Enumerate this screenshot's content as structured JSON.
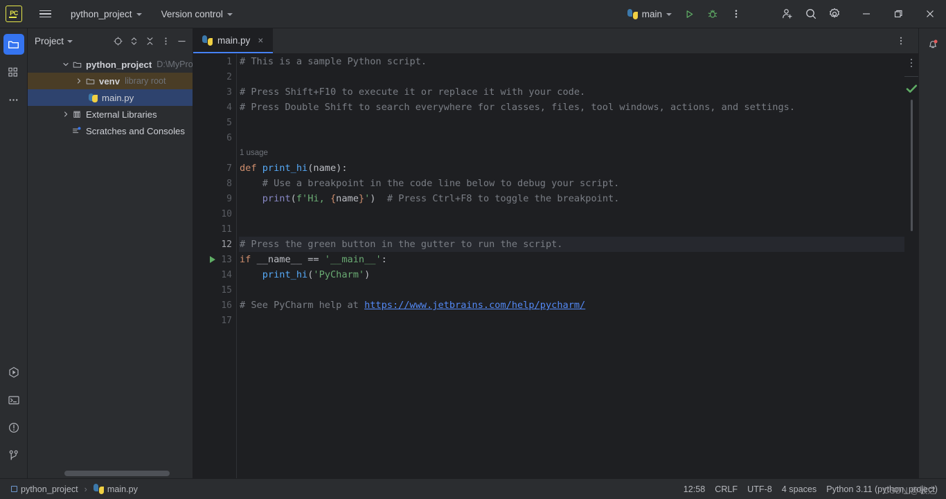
{
  "titlebar": {
    "logo": "pycharm-logo",
    "project_name": "python_project",
    "version_control": "Version control",
    "run_config": "main",
    "icons": {
      "menu": "hamburger-icon",
      "run": "run-icon",
      "debug": "debug-icon",
      "more": "more-vertical-icon",
      "account": "user-add-icon",
      "search": "search-icon",
      "settings": "gear-icon",
      "minimize": "minimize-icon",
      "maximize": "maximize-icon",
      "close": "close-icon"
    }
  },
  "activitybar": {
    "top_items": [
      {
        "name": "project-tool-icon",
        "label": "Project",
        "active": true
      },
      {
        "name": "structure-tool-icon",
        "label": "Structure",
        "active": false
      },
      {
        "name": "more-tool-windows-icon",
        "label": "More tool windows",
        "active": false
      }
    ],
    "bottom_items": [
      {
        "name": "run-tool-icon",
        "label": "Run"
      },
      {
        "name": "terminal-tool-icon",
        "label": "Terminal"
      },
      {
        "name": "problems-tool-icon",
        "label": "Problems"
      },
      {
        "name": "version-control-tool-icon",
        "label": "Version Control"
      }
    ]
  },
  "project_panel": {
    "title": "Project",
    "actions": [
      {
        "name": "select-opened-file-icon",
        "label": "Select Opened File"
      },
      {
        "name": "expand-collapse-icon",
        "label": "Expand / Collapse"
      },
      {
        "name": "collapse-all-icon",
        "label": "Collapse All"
      },
      {
        "name": "options-icon",
        "label": "Options"
      },
      {
        "name": "hide-icon",
        "label": "Hide"
      }
    ],
    "tree": [
      {
        "label": "python_project",
        "suffix": "D:\\MyProject\\",
        "icon": "folder-icon",
        "depth": 0,
        "expanded": true,
        "bold": true,
        "state": "none"
      },
      {
        "label": "venv",
        "suffix": "library root",
        "icon": "folder-icon",
        "depth": 1,
        "expanded": false,
        "bold": true,
        "state": "venv"
      },
      {
        "label": "main.py",
        "suffix": "",
        "icon": "python-file-icon",
        "depth": 1,
        "expanded": null,
        "bold": false,
        "state": "selected"
      },
      {
        "label": "External Libraries",
        "suffix": "",
        "icon": "library-icon",
        "depth": 0,
        "expanded": false,
        "bold": false,
        "state": "none"
      },
      {
        "label": "Scratches and Consoles",
        "suffix": "",
        "icon": "scratches-icon",
        "depth": 0,
        "expanded": null,
        "bold": false,
        "state": "none"
      }
    ]
  },
  "editor": {
    "tabs": [
      {
        "label": "main.py",
        "icon": "python-file-icon",
        "active": true,
        "close": "×"
      }
    ],
    "tab_actions": [
      {
        "name": "editor-options-icon",
        "label": "Options"
      }
    ],
    "inspection_status": "ok-check-icon",
    "lines": [
      {
        "num": "1",
        "tokens": [
          {
            "t": "# This is a sample Python script.",
            "c": "com"
          }
        ]
      },
      {
        "num": "2",
        "tokens": []
      },
      {
        "num": "3",
        "tokens": [
          {
            "t": "# Press Shift+F10 to execute it or replace it with your code.",
            "c": "com"
          }
        ]
      },
      {
        "num": "4",
        "tokens": [
          {
            "t": "# Press Double Shift to search everywhere for classes, files, tool windows, actions, and settings.",
            "c": "com"
          }
        ]
      },
      {
        "num": "5",
        "tokens": []
      },
      {
        "num": "6",
        "tokens": []
      },
      {
        "num": "7",
        "hint": "1 usage",
        "tokens": [
          {
            "t": "def ",
            "c": "kw"
          },
          {
            "t": "print_hi",
            "c": "fndef"
          },
          {
            "t": "(name):",
            "c": "id"
          }
        ]
      },
      {
        "num": "8",
        "tokens": [
          {
            "t": "    # Use a breakpoint in the code line below to debug your script.",
            "c": "com"
          }
        ]
      },
      {
        "num": "9",
        "tokens": [
          {
            "t": "    ",
            "c": "id"
          },
          {
            "t": "print",
            "c": "bi"
          },
          {
            "t": "(",
            "c": "id"
          },
          {
            "t": "f'Hi, ",
            "c": "str"
          },
          {
            "t": "{",
            "c": "brace"
          },
          {
            "t": "name",
            "c": "id"
          },
          {
            "t": "}",
            "c": "brace"
          },
          {
            "t": "'",
            "c": "str"
          },
          {
            "t": ")  ",
            "c": "id"
          },
          {
            "t": "# Press Ctrl+F8 to toggle the breakpoint.",
            "c": "com"
          }
        ]
      },
      {
        "num": "10",
        "tokens": []
      },
      {
        "num": "11",
        "tokens": []
      },
      {
        "num": "12",
        "highlight": true,
        "tokens": [
          {
            "t": "# Press the green button in the gutter to run the script.",
            "c": "com"
          }
        ]
      },
      {
        "num": "13",
        "gutter_run": true,
        "tokens": [
          {
            "t": "if ",
            "c": "kw"
          },
          {
            "t": "__name__ ",
            "c": "id"
          },
          {
            "t": "== ",
            "c": "op"
          },
          {
            "t": "'__main__'",
            "c": "str"
          },
          {
            "t": ":",
            "c": "id"
          }
        ]
      },
      {
        "num": "14",
        "tokens": [
          {
            "t": "    ",
            "c": "id"
          },
          {
            "t": "print_hi",
            "c": "fn"
          },
          {
            "t": "(",
            "c": "id"
          },
          {
            "t": "'PyCharm'",
            "c": "str"
          },
          {
            "t": ")",
            "c": "id"
          }
        ]
      },
      {
        "num": "15",
        "tokens": []
      },
      {
        "num": "16",
        "tokens": [
          {
            "t": "# See PyCharm help at ",
            "c": "com"
          },
          {
            "t": "https://www.jetbrains.com/help/pycharm/",
            "c": "link"
          }
        ]
      },
      {
        "num": "17",
        "tokens": []
      }
    ]
  },
  "notifications": {
    "icon": "bell-icon",
    "has_unread": true
  },
  "statusbar": {
    "breadcrumb": [
      {
        "label": "python_project",
        "icon": "project-icon"
      },
      {
        "label": "main.py",
        "icon": "python-file-icon"
      }
    ],
    "separator": "›",
    "position": "12:58",
    "line_separator": "CRLF",
    "encoding": "UTF-8",
    "indent": "4 spaces",
    "interpreter": "Python 3.11 (python_project)",
    "watermark": "CSDN @敬之"
  },
  "colors": {
    "accent": "#3574f0",
    "tab_underline": "#4682fa",
    "comment": "#7a7e85",
    "keyword": "#cf8e6d",
    "function": "#56a8f5",
    "builtin": "#8888c6",
    "string": "#6aab73",
    "identifier": "#bcbec4",
    "link": "#548af7",
    "run_green": "#5fad65",
    "selection_blue": "#2e436e",
    "venv_highlight": "#4a3d26",
    "background": "#1e1f22",
    "chrome": "#2b2d30",
    "notification_dot": "#e55c5c"
  }
}
